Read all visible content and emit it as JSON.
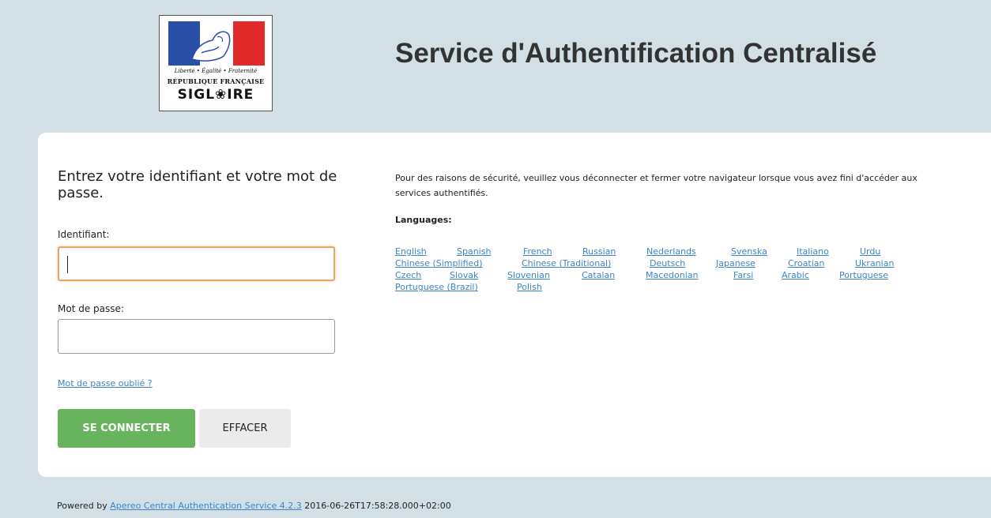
{
  "header": {
    "logo": {
      "motto": "Liberté • Égalité • Fraternité",
      "republic": "RÉPUBLIQUE FRANÇAISE",
      "sigle": "SIGL❀IRE"
    },
    "title": "Service d'Authentification Centralisé"
  },
  "login": {
    "heading": "Entrez votre identifiant et votre mot de passe.",
    "username_label": "Identifiant:",
    "username_value": "",
    "password_label": "Mot de passe:",
    "password_value": "",
    "forgot_link": "Mot de passe oublié ?",
    "submit_label": "SE CONNECTER",
    "clear_label": "EFFACER"
  },
  "info": {
    "notice": "Pour des raisons de sécurité, veuillez vous déconnecter et fermer votre navigateur lorsque vous avez fini d'accéder aux services authentifiés.",
    "languages_title": "Languages:",
    "languages": [
      "English",
      "Spanish",
      "French",
      "Russian",
      "Nederlands",
      "Svenska",
      "Italiano",
      "Urdu",
      "Chinese (Simplified)",
      "Chinese (Traditional)",
      "Deutsch",
      "Japanese",
      "Croatian",
      "Ukranian",
      "Czech",
      "Slovak",
      "Slovenian",
      "Catalan",
      "Macedonian",
      "Farsi",
      "Arabic",
      "Portuguese",
      "Portuguese (Brazil)",
      "Polish"
    ]
  },
  "footer": {
    "prefix": "Powered by",
    "link": "Apereo Central Authentication Service 4.2.3",
    "timestamp": "2016-06-26T17:58:28.000+02:00"
  },
  "colors": {
    "background": "#d2dfe5",
    "primary_button": "#68b35d",
    "link": "#3a86c8",
    "focus_border": "#e5a46a"
  }
}
